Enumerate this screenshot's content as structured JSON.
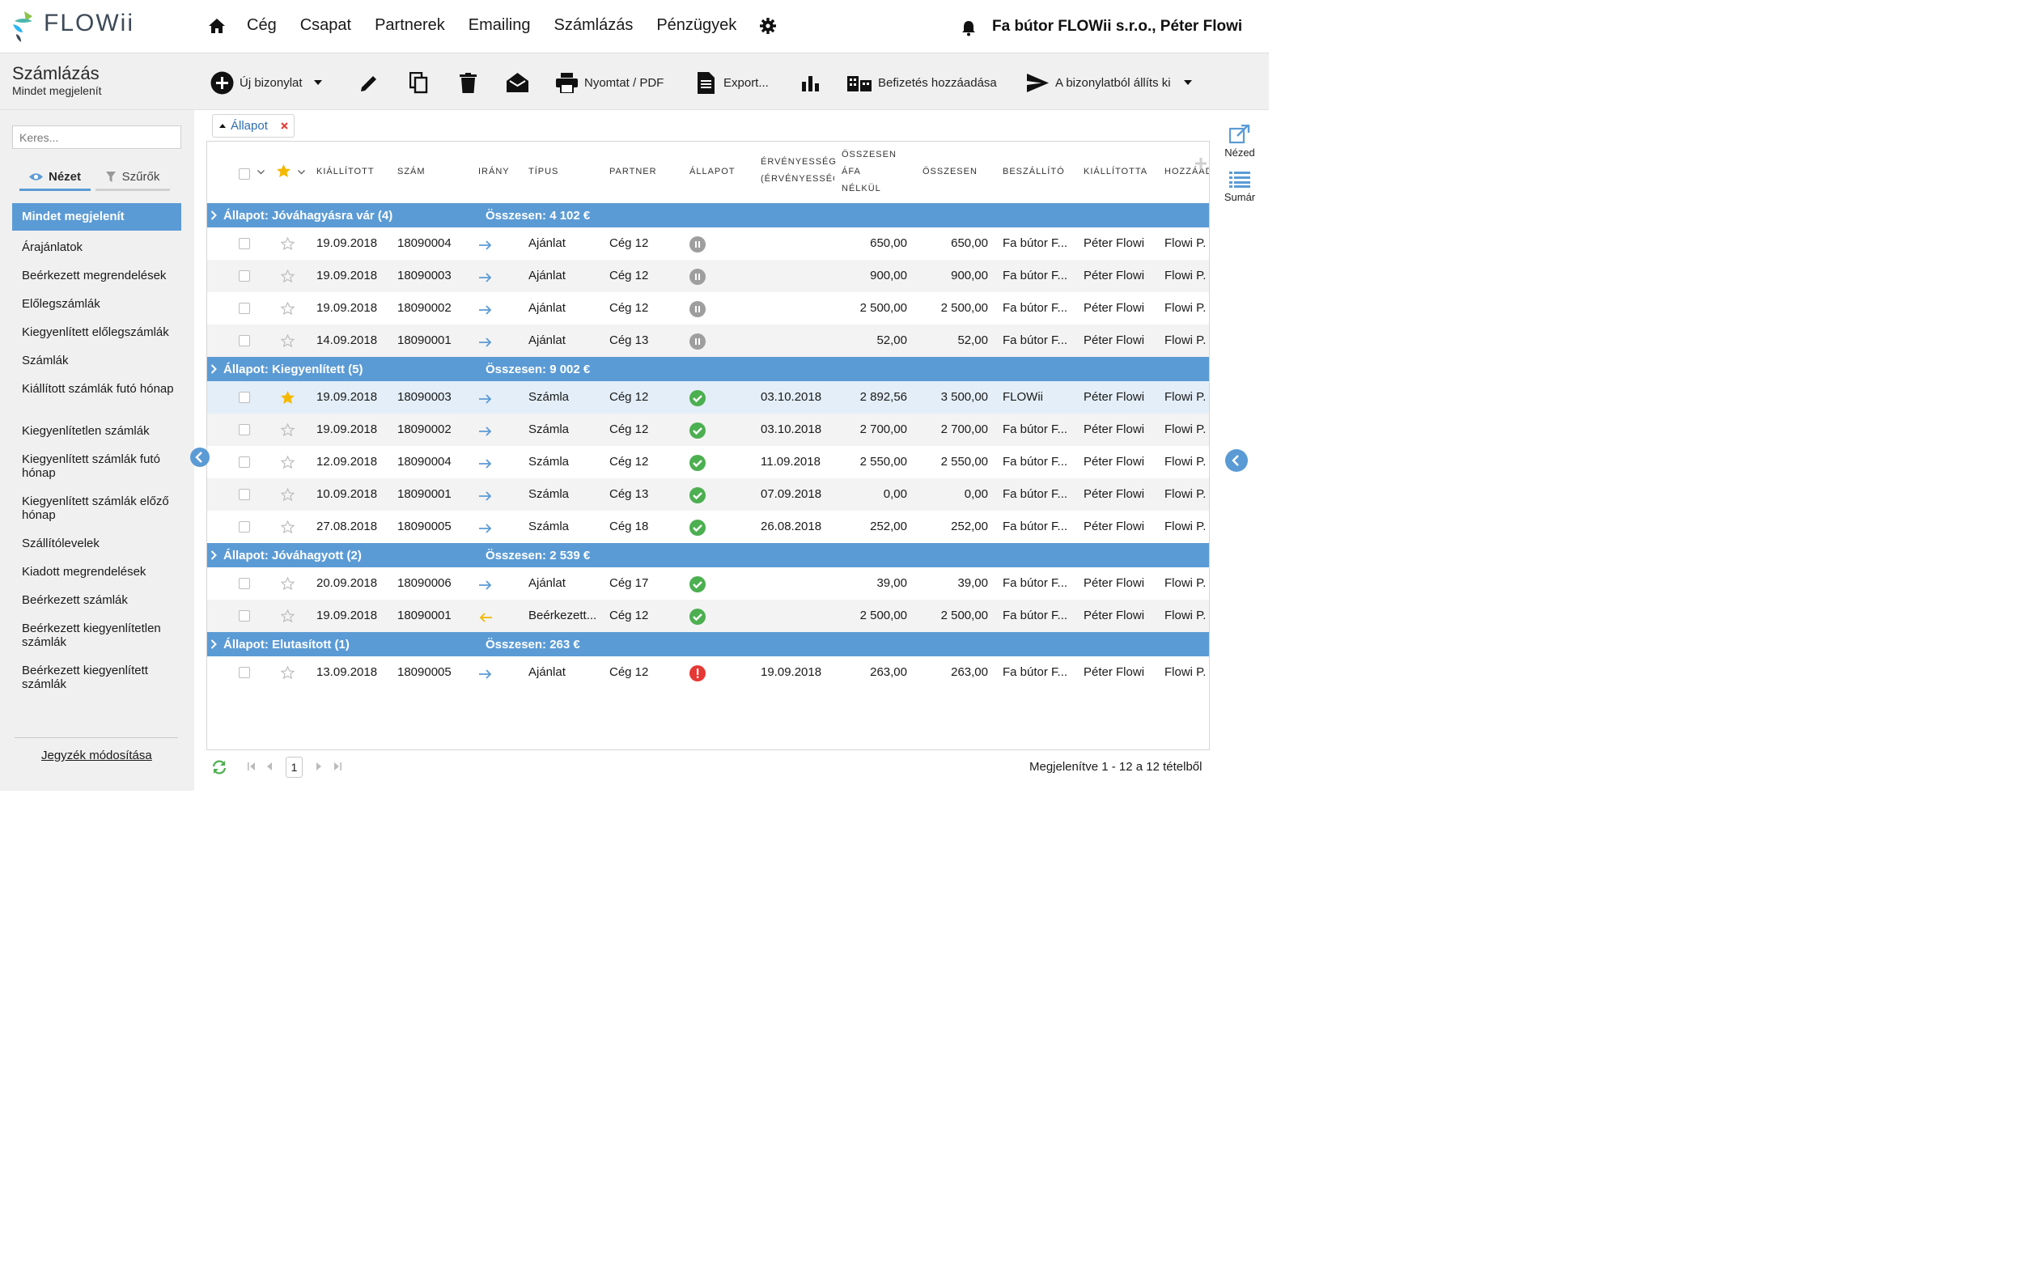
{
  "topbar": {
    "logo_text": "FLOWii",
    "nav": [
      "Cég",
      "Csapat",
      "Partnerek",
      "Emailing",
      "Számlázás",
      "Pénzügyek"
    ],
    "company": "Fa bútor FLOWii s.r.o., Péter Flowi"
  },
  "page": {
    "title": "Számlázás",
    "subtitle": "Mindet megjelenít"
  },
  "toolbar": {
    "new_doc": "Új bizonylat",
    "print": "Nyomtat / PDF",
    "export": "Export...",
    "add_payment": "Befizetés hozzáadása",
    "issue_from": "A bizonylatból állíts ki"
  },
  "sidebar": {
    "search_placeholder": "Keres...",
    "tab_view": "Nézet",
    "tab_filters": "Szűrők",
    "active": "Mindet megjelenít",
    "items": [
      "Árajánlatok",
      "Beérkezett megrendelések",
      "Előlegszámlák",
      "Kiegyenlített előlegszámlák",
      "Számlák",
      "Kiállított számlák futó hónap",
      "Kiegyenlítetlen számlák",
      "Kiegyenlített számlák futó hónap",
      "Kiegyenlített számlák előző hónap",
      "Szállítólevelek",
      "Kiadott megrendelések",
      "Beérkezett számlák",
      "Beérkezett kiegyenlítetlen számlák",
      "Beérkezett kiegyenlített számlák"
    ],
    "edit_link": "Jegyzék módosítása"
  },
  "filter_chip": "Állapot",
  "columns": {
    "issued": "KIÁLLÍTOTT",
    "number": "SZÁM",
    "direction": "IRÁNY",
    "type": "TÍPUS",
    "partner": "PARTNER",
    "status": "ÁLLAPOT",
    "validity1": "ÉRVÉNYESSÉG",
    "validity2": "(ÉRVÉNYESSÉG",
    "net1": "ÖSSZESEN",
    "net2": "ÁFA",
    "net3": "NÉLKÜL",
    "total": "ÖSSZESEN",
    "supplier": "BESZÁLLÍTÓ",
    "issuer": "KIÁLLÍTOTTA",
    "added": "HOZZÁAD"
  },
  "groups": [
    {
      "label": "Állapot: Jóváhagyásra vár (4)",
      "sum": "Összesen: 4 102 €",
      "rows": [
        {
          "starred": false,
          "issued": "19.09.2018",
          "number": "18090004",
          "dir": "out",
          "type": "Ajánlat",
          "partner": "Cég 12",
          "status": "pause",
          "validity": "",
          "net": "650,00",
          "total": "650,00",
          "supplier": "Fa bútor F...",
          "issuer": "Péter Flowi",
          "added": "Flowi P."
        },
        {
          "starred": false,
          "issued": "19.09.2018",
          "number": "18090003",
          "dir": "out",
          "type": "Ajánlat",
          "partner": "Cég 12",
          "status": "pause",
          "validity": "",
          "net": "900,00",
          "total": "900,00",
          "supplier": "Fa bútor F...",
          "issuer": "Péter Flowi",
          "added": "Flowi P."
        },
        {
          "starred": false,
          "issued": "19.09.2018",
          "number": "18090002",
          "dir": "out",
          "type": "Ajánlat",
          "partner": "Cég 12",
          "status": "pause",
          "validity": "",
          "net": "2 500,00",
          "total": "2 500,00",
          "supplier": "Fa bútor F...",
          "issuer": "Péter Flowi",
          "added": "Flowi P."
        },
        {
          "starred": false,
          "issued": "14.09.2018",
          "number": "18090001",
          "dir": "out",
          "type": "Ajánlat",
          "partner": "Cég 13",
          "status": "pause",
          "validity": "",
          "net": "52,00",
          "total": "52,00",
          "supplier": "Fa bútor F...",
          "issuer": "Péter Flowi",
          "added": "Flowi P."
        }
      ]
    },
    {
      "label": "Állapot: Kiegyenlített (5)",
      "sum": "Összesen: 9 002 €",
      "rows": [
        {
          "starred": true,
          "issued": "19.09.2018",
          "number": "18090003",
          "dir": "out",
          "type": "Számla",
          "partner": "Cég 12",
          "status": "ok",
          "validity": "03.10.2018",
          "net": "2 892,56",
          "total": "3 500,00",
          "supplier": "FLOWii",
          "issuer": "Péter Flowi",
          "added": "Flowi P."
        },
        {
          "starred": false,
          "issued": "19.09.2018",
          "number": "18090002",
          "dir": "out",
          "type": "Számla",
          "partner": "Cég 12",
          "status": "ok",
          "validity": "03.10.2018",
          "net": "2 700,00",
          "total": "2 700,00",
          "supplier": "Fa bútor F...",
          "issuer": "Péter Flowi",
          "added": "Flowi P."
        },
        {
          "starred": false,
          "issued": "12.09.2018",
          "number": "18090004",
          "dir": "out",
          "type": "Számla",
          "partner": "Cég 12",
          "status": "ok",
          "validity": "11.09.2018",
          "net": "2 550,00",
          "total": "2 550,00",
          "supplier": "Fa bútor F...",
          "issuer": "Péter Flowi",
          "added": "Flowi P."
        },
        {
          "starred": false,
          "issued": "10.09.2018",
          "number": "18090001",
          "dir": "out",
          "type": "Számla",
          "partner": "Cég 13",
          "status": "ok",
          "validity": "07.09.2018",
          "net": "0,00",
          "total": "0,00",
          "supplier": "Fa bútor F...",
          "issuer": "Péter Flowi",
          "added": "Flowi P."
        },
        {
          "starred": false,
          "issued": "27.08.2018",
          "number": "18090005",
          "dir": "out",
          "type": "Számla",
          "partner": "Cég 18",
          "status": "ok",
          "validity": "26.08.2018",
          "net": "252,00",
          "total": "252,00",
          "supplier": "Fa bútor F...",
          "issuer": "Péter Flowi",
          "added": "Flowi P."
        }
      ]
    },
    {
      "label": "Állapot: Jóváhagyott (2)",
      "sum": "Összesen: 2 539 €",
      "rows": [
        {
          "starred": false,
          "issued": "20.09.2018",
          "number": "18090006",
          "dir": "out",
          "type": "Ajánlat",
          "partner": "Cég 17",
          "status": "ok",
          "validity": "",
          "net": "39,00",
          "total": "39,00",
          "supplier": "Fa bútor F...",
          "issuer": "Péter Flowi",
          "added": "Flowi P."
        },
        {
          "starred": false,
          "issued": "19.09.2018",
          "number": "18090001",
          "dir": "in",
          "type": "Beérkezett...",
          "partner": "Cég 12",
          "status": "ok",
          "validity": "",
          "net": "2 500,00",
          "total": "2 500,00",
          "supplier": "Fa bútor F...",
          "issuer": "Péter Flowi",
          "added": "Flowi P."
        }
      ]
    },
    {
      "label": "Állapot: Elutasított (1)",
      "sum": "Összesen: 263 €",
      "rows": [
        {
          "starred": false,
          "issued": "13.09.2018",
          "number": "18090005",
          "dir": "out",
          "type": "Ajánlat",
          "partner": "Cég 12",
          "status": "error",
          "validity": "19.09.2018",
          "net": "263,00",
          "total": "263,00",
          "supplier": "Fa bútor F...",
          "issuer": "Péter Flowi",
          "added": "Flowi P."
        }
      ]
    }
  ],
  "pager": {
    "page": "1",
    "info": "Megjelenítve 1 - 12 a 12 tételből"
  },
  "right_panel": {
    "view": "Nézed",
    "summary": "Sumár"
  },
  "colors": {
    "accent": "#5b9bd5",
    "ok": "#4caf50",
    "pause": "#9e9e9e",
    "error": "#e53935",
    "star": "#f5b800",
    "arrow_out": "#5b9bd5",
    "arrow_in": "#f5b800"
  }
}
